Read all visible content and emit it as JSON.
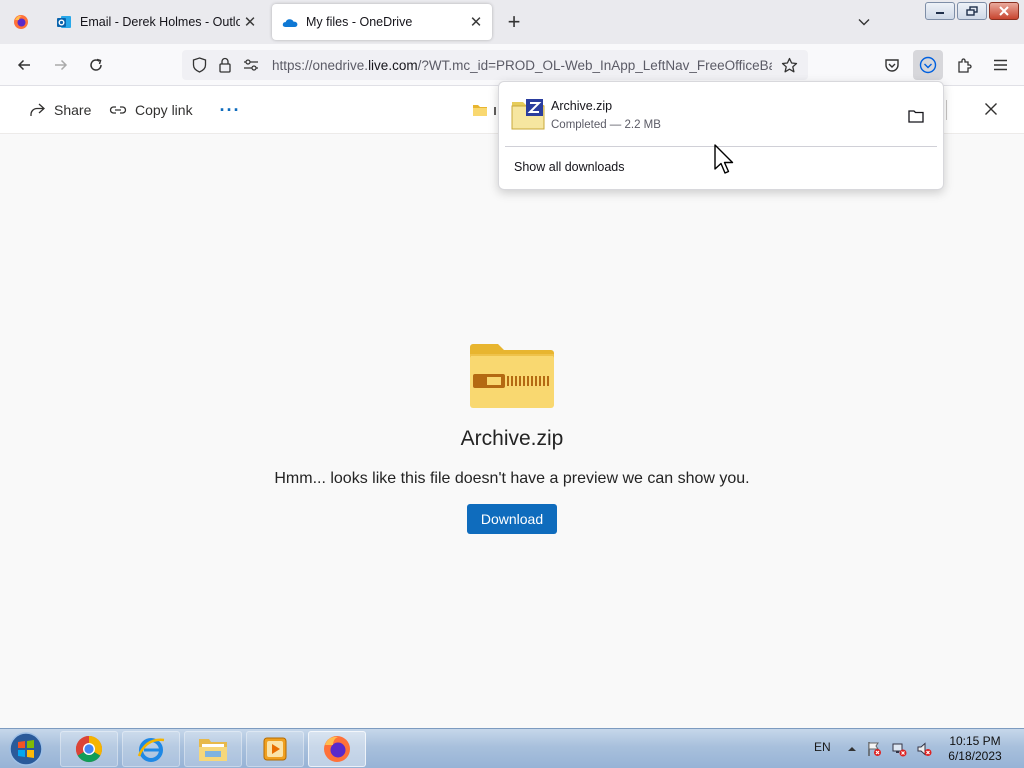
{
  "browser": {
    "tabs": [
      {
        "title": "Email - Derek Holmes - Outlook",
        "active": false
      },
      {
        "title": "My files - OneDrive",
        "active": true
      }
    ],
    "url_prefix": "https://onedrive.",
    "url_domain": "live.com",
    "url_suffix": "/?WT.mc_id=PROD_OL-Web_InApp_LeftNav_FreeOfficeBa"
  },
  "command_bar": {
    "share_label": "Share",
    "copy_link_label": "Copy link",
    "more_label": "···"
  },
  "preview": {
    "file_name": "Archive.zip",
    "message": "Hmm... looks like this file doesn't have a preview we can show you.",
    "download_label": "Download"
  },
  "downloads_panel": {
    "item_name": "Archive.zip",
    "item_status": "Completed — 2.2 MB",
    "show_all_label": "Show all downloads"
  },
  "taskbar": {
    "language": "EN",
    "time": "10:15 PM",
    "date": "6/18/2023"
  },
  "colors": {
    "accent": "#0f6cbd",
    "folder_yellow": "#f9d870",
    "folder_dark": "#e8b52f"
  }
}
